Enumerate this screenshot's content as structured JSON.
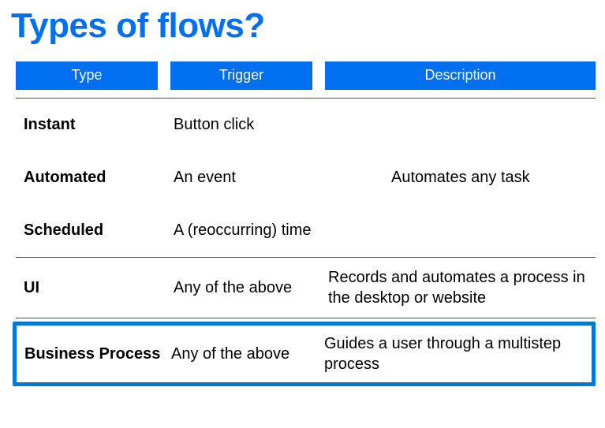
{
  "title": "Types of flows?",
  "colors": {
    "accent": "#0070f0"
  },
  "headers": {
    "type": "Type",
    "trigger": "Trigger",
    "description": "Description"
  },
  "rows": [
    {
      "type": "Instant",
      "trigger": "Button click",
      "description": ""
    },
    {
      "type": "Automated",
      "trigger": "An event",
      "description": "Automates any task"
    },
    {
      "type": "Scheduled",
      "trigger": "A (reoccurring) time",
      "description": ""
    },
    {
      "type": "UI",
      "trigger": "Any of the above",
      "description": "Records and automates a process in the desktop or website"
    },
    {
      "type": "Business Process",
      "trigger": "Any of the above",
      "description": "Guides a user through a multistep process"
    }
  ],
  "highlighted_row_index": 4
}
